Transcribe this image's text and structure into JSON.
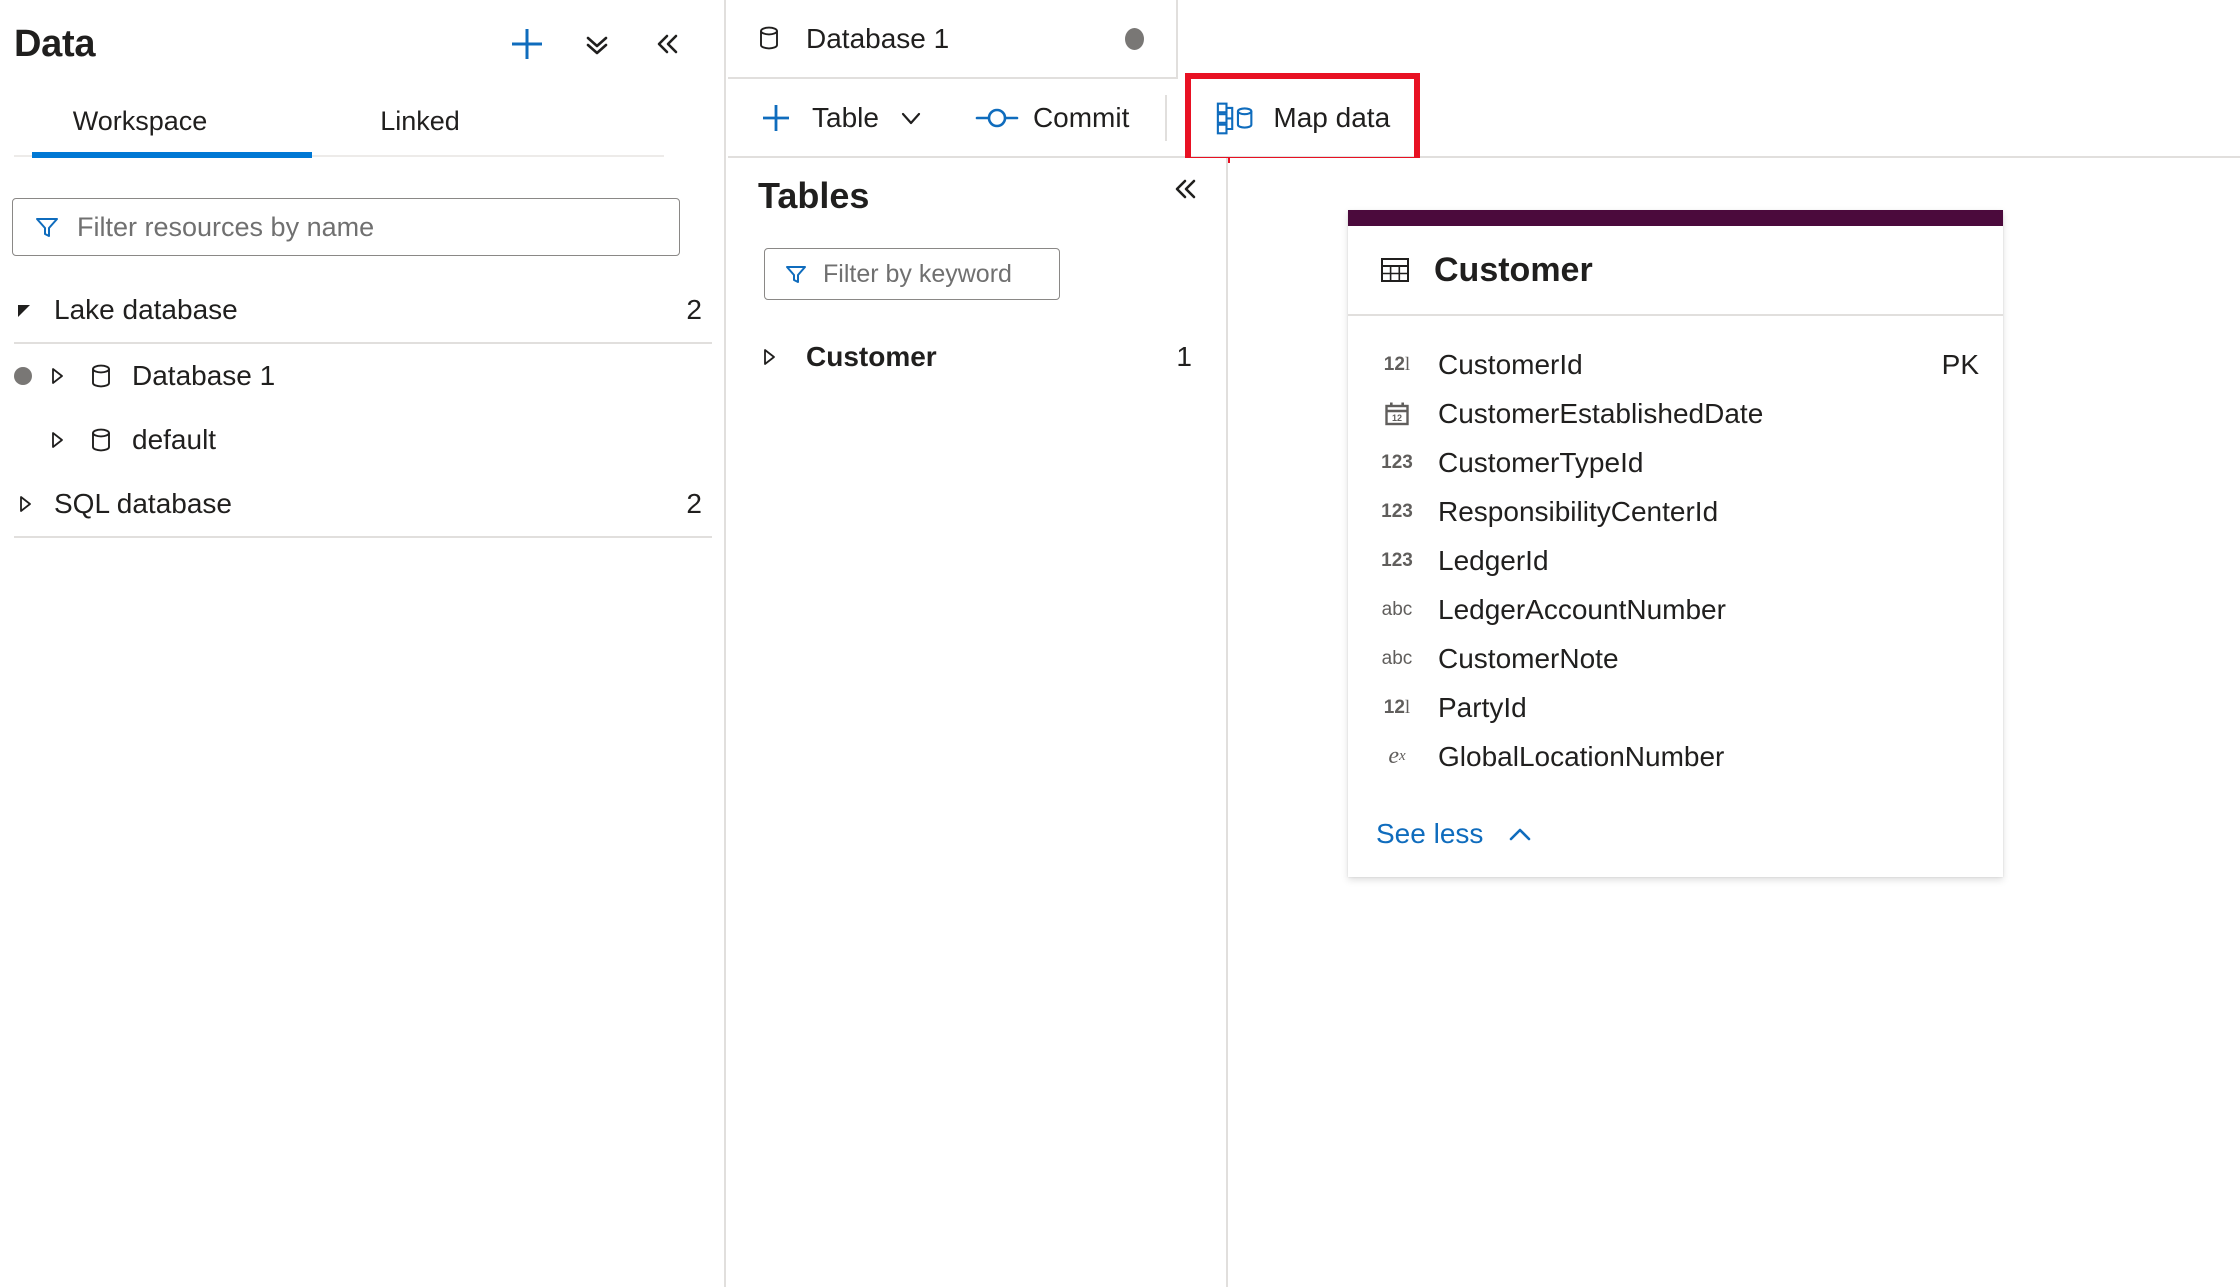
{
  "sidebar": {
    "title": "Data",
    "actions": [
      {
        "name": "add-new-resource-button",
        "icon": "plus-icon",
        "label": "+"
      },
      {
        "name": "collapse-all-button",
        "icon": "double-chevron-down-icon",
        "label": "˅˅"
      },
      {
        "name": "collapse-panel-button",
        "icon": "double-chevron-left-icon",
        "label": "«"
      }
    ],
    "tabs": [
      {
        "label": "Workspace",
        "active": true
      },
      {
        "label": "Linked",
        "active": false
      }
    ],
    "filter": {
      "placeholder": "Filter resources by name",
      "value": "",
      "icon": "filter-icon"
    },
    "tree": [
      {
        "label": "Lake database",
        "count": "2",
        "expanded": true,
        "children": [
          {
            "label": "Database 1",
            "icon": "database-icon",
            "status_dot": true,
            "expanded": false
          },
          {
            "label": "default",
            "icon": "database-icon",
            "status_dot": false,
            "expanded": false
          }
        ]
      },
      {
        "label": "SQL database",
        "count": "2",
        "expanded": false,
        "children": []
      }
    ]
  },
  "document_tab": {
    "label": "Database 1",
    "icon": "database-icon",
    "dirty_indicator": true
  },
  "command_bar": {
    "commands": [
      {
        "name": "add-table-button",
        "label": "Table",
        "icon": "plus-icon",
        "has_caret": true,
        "highlighted": false
      },
      {
        "name": "commit-button",
        "label": "Commit",
        "icon": "commit-icon",
        "has_caret": false,
        "highlighted": false
      },
      {
        "name": "map-data-button",
        "label": "Map data",
        "icon": "map-data-icon",
        "has_caret": false,
        "highlighted": true
      }
    ],
    "highlight_color": "#e81123"
  },
  "tables_panel": {
    "title": "Tables",
    "collapse_icon": "double-chevron-left-icon",
    "filter": {
      "placeholder": "Filter by keyword",
      "value": "",
      "icon": "filter-icon"
    },
    "rows": [
      {
        "label": "Customer",
        "count": "1",
        "expanded": false
      }
    ]
  },
  "entity_card": {
    "accent_color": "#4B0A3C",
    "title": "Customer",
    "title_icon": "table-icon",
    "fields": [
      {
        "name": "CustomerId",
        "type_icon": "long-type-icon",
        "type_glyph": "12l",
        "key": "PK"
      },
      {
        "name": "CustomerEstablishedDate",
        "type_icon": "date-type-icon",
        "type_glyph": "cal",
        "key": ""
      },
      {
        "name": "CustomerTypeId",
        "type_icon": "integer-type-icon",
        "type_glyph": "123",
        "key": ""
      },
      {
        "name": "ResponsibilityCenterId",
        "type_icon": "integer-type-icon",
        "type_glyph": "123",
        "key": ""
      },
      {
        "name": "LedgerId",
        "type_icon": "integer-type-icon",
        "type_glyph": "123",
        "key": ""
      },
      {
        "name": "LedgerAccountNumber",
        "type_icon": "string-type-icon",
        "type_glyph": "abc",
        "key": ""
      },
      {
        "name": "CustomerNote",
        "type_icon": "string-type-icon",
        "type_glyph": "abc",
        "key": ""
      },
      {
        "name": "PartyId",
        "type_icon": "long-type-icon",
        "type_glyph": "12l",
        "key": ""
      },
      {
        "name": "GlobalLocationNumber",
        "type_icon": "decimal-type-icon",
        "type_glyph": "ex",
        "key": ""
      }
    ],
    "footer": {
      "label": "See less",
      "icon": "chevron-up-icon"
    }
  }
}
